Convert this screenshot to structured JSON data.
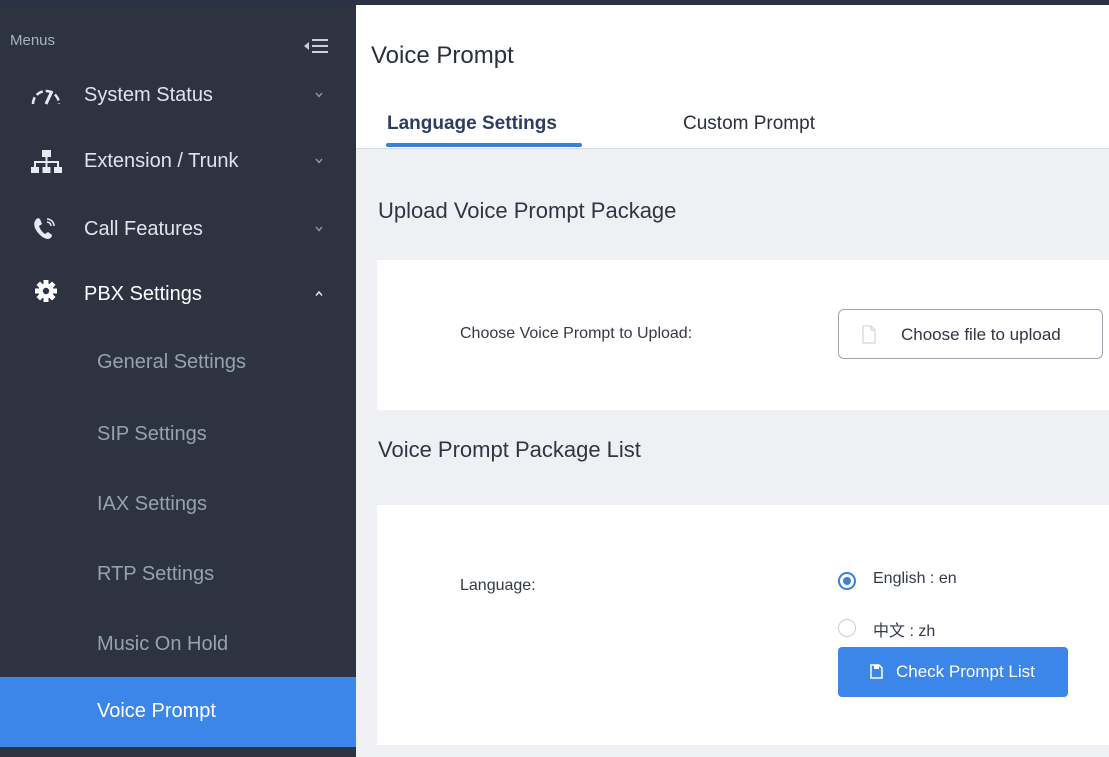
{
  "sidebar": {
    "menus_label": "Menus",
    "items": [
      {
        "label": "System Status",
        "icon": "speedometer-icon",
        "expanded": false
      },
      {
        "label": "Extension / Trunk",
        "icon": "network-icon",
        "expanded": false
      },
      {
        "label": "Call Features",
        "icon": "phone-icon",
        "expanded": false
      },
      {
        "label": "PBX Settings",
        "icon": "gear-icon",
        "expanded": true
      }
    ],
    "sub_items": [
      {
        "label": "General Settings",
        "active": false
      },
      {
        "label": "SIP Settings",
        "active": false
      },
      {
        "label": "IAX Settings",
        "active": false
      },
      {
        "label": "RTP Settings",
        "active": false
      },
      {
        "label": "Music On Hold",
        "active": false
      },
      {
        "label": "Voice Prompt",
        "active": true
      }
    ]
  },
  "main": {
    "title": "Voice Prompt",
    "tabs": [
      {
        "label": "Language Settings",
        "active": true
      },
      {
        "label": "Custom Prompt",
        "active": false
      }
    ],
    "upload_section": {
      "title": "Upload Voice Prompt Package",
      "field_label": "Choose Voice Prompt to Upload:",
      "button_label": "Choose file to upload"
    },
    "list_section": {
      "title": "Voice Prompt Package List",
      "field_label": "Language:",
      "options": [
        {
          "label": "English : en",
          "selected": true
        },
        {
          "label": "中文 : zh",
          "selected": false
        }
      ],
      "button_label": "Check Prompt List"
    }
  },
  "colors": {
    "sidebar_bg": "#2d3340",
    "accent": "#3b86e8",
    "content_bg": "#eef0f4"
  }
}
